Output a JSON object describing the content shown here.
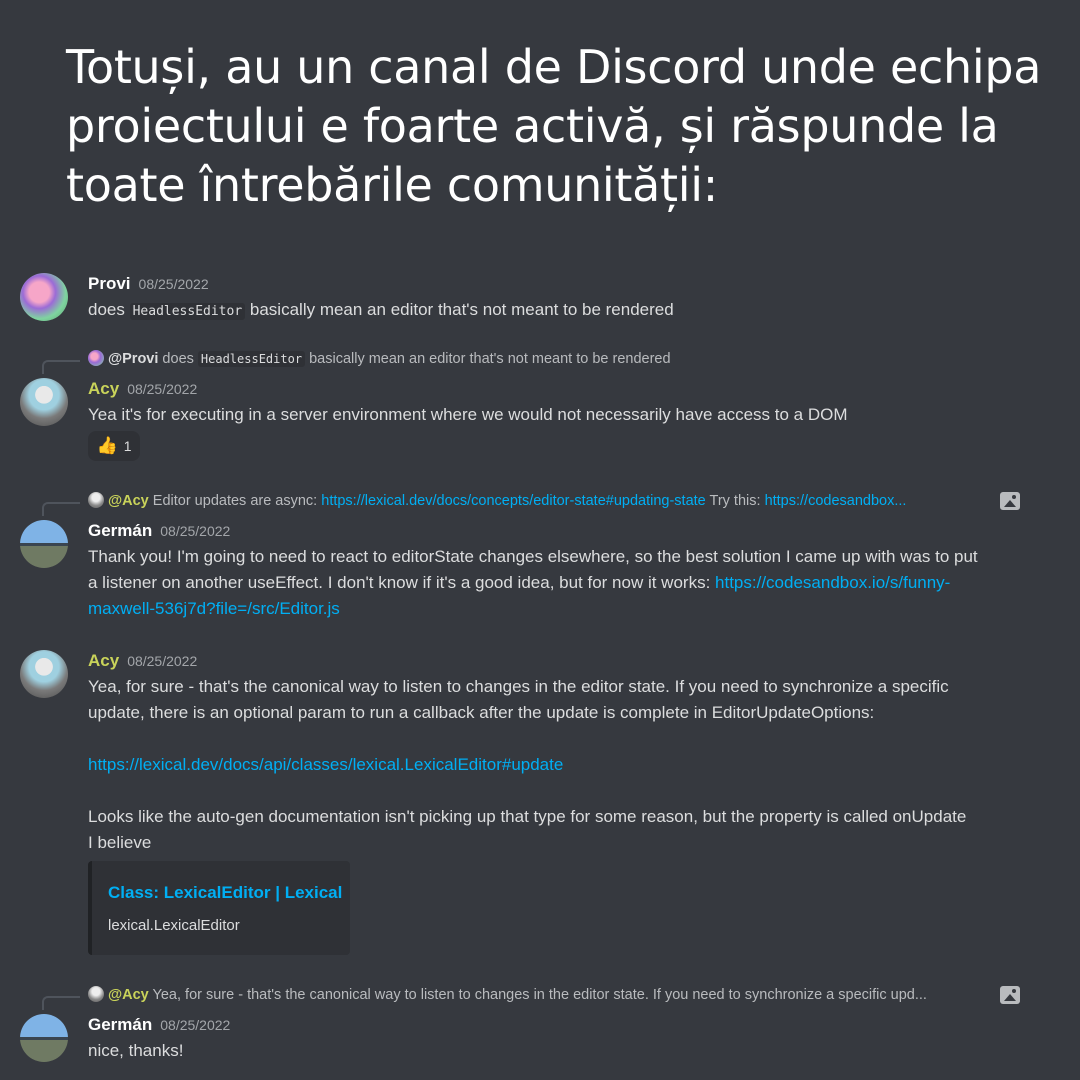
{
  "slide": {
    "title": "Totuși, au un canal de Discord unde echipa proiectului e foarte activă, și răspunde la toate întrebările comunității:"
  },
  "messages": [
    {
      "author": "Provi",
      "date": "08/25/2022",
      "text_before": "does ",
      "code": "HeadlessEditor",
      "text_after": " basically mean an editor that's not meant to be rendered"
    },
    {
      "reply": {
        "author": "@Provi",
        "text_before": " does ",
        "code": "HeadlessEditor",
        "text_after": " basically mean an editor that's not meant to be rendered"
      },
      "author": "Acy",
      "date": "08/25/2022",
      "text": "Yea it's for executing in a server environment where we would not necessarily have access to a DOM",
      "reaction": {
        "emoji": "👍",
        "count": "1"
      }
    },
    {
      "reply": {
        "author": "@Acy",
        "text_before": " Editor updates are async: ",
        "link1": "https://lexical.dev/docs/concepts/editor-state#updating-state",
        "text_mid": "  Try this: ",
        "link2": "https://codesandbox..."
      },
      "author": "Germán",
      "date": "08/25/2022",
      "text_line1": "Thank you! I'm going to need to react to editorState changes elsewhere, so the best solution I came up with was to put",
      "text_line2": "a listener on another useEffect. I don't know if it's a good idea, but for now it works: ",
      "link_part1": "https://codesandbox.io/s/funny-",
      "link_part2": "maxwell-536j7d?file=/src/Editor.js"
    },
    {
      "author": "Acy",
      "date": "08/25/2022",
      "para1_line1": "Yea, for sure - that's the canonical way to listen to changes in the editor state. If you need to synchronize a specific",
      "para1_line2": "update, there is an optional param to run a callback after the update is complete in EditorUpdateOptions:",
      "link": "https://lexical.dev/docs/api/classes/lexical.LexicalEditor#update",
      "para2_line1": "Looks like the auto-gen documentation isn't picking up that type for some reason, but the property is called onUpdate",
      "para2_line2": "I believe",
      "embed": {
        "title": "Class: LexicalEditor | Lexical",
        "description": "lexical.LexicalEditor"
      }
    },
    {
      "reply": {
        "author": "@Acy",
        "text": " Yea, for sure - that's the canonical way to listen to changes in the editor state. If you need to synchronize a specific upd..."
      },
      "author": "Germán",
      "date": "08/25/2022",
      "text": "nice, thanks!"
    }
  ]
}
